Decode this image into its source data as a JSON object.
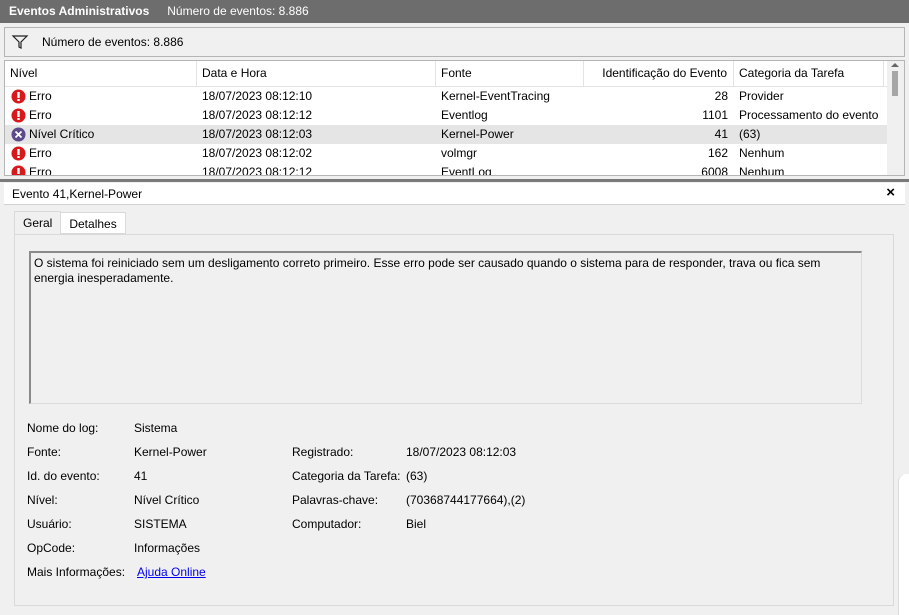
{
  "titlebar": {
    "title": "Eventos Administrativos",
    "count": "Número de eventos: 8.886"
  },
  "filter": {
    "icon": "funnel-icon",
    "count": "Número de eventos: 8.886"
  },
  "table": {
    "columns": [
      "Nível",
      "Data e Hora",
      "Fonte",
      "Identificação do Evento",
      "Categoria da Tarefa"
    ],
    "rows": [
      {
        "icon": "error-icon",
        "level": "Erro",
        "date": "18/07/2023 08:12:10",
        "source": "Kernel-EventTracing",
        "id": "28",
        "category": "Provider"
      },
      {
        "icon": "error-icon",
        "level": "Erro",
        "date": "18/07/2023 08:12:12",
        "source": "Eventlog",
        "id": "1101",
        "category": "Processamento do evento"
      },
      {
        "icon": "critical-icon",
        "level": "Nível Crítico",
        "date": "18/07/2023 08:12:03",
        "source": "Kernel-Power",
        "id": "41",
        "category": "(63)"
      },
      {
        "icon": "error-icon",
        "level": "Erro",
        "date": "18/07/2023 08:12:02",
        "source": "volmgr",
        "id": "162",
        "category": "Nenhum"
      },
      {
        "icon": "error-icon",
        "level": "Erro",
        "date": "18/07/2023 08:12:12",
        "source": "EventLog",
        "id": "6008",
        "category": "Nenhum"
      }
    ]
  },
  "detail": {
    "header": "Evento 41,Kernel-Power",
    "close": "×",
    "tabs": [
      "Geral",
      "Detalhes"
    ],
    "description": "O sistema foi reiniciado sem um desligamento correto primeiro. Esse erro pode ser causado quando o sistema para de responder, trava ou fica sem energia inesperadamente.",
    "fields": {
      "log_label": "Nome do log:",
      "log_value": "Sistema",
      "source_label": "Fonte:",
      "source_value": "Kernel-Power",
      "eventid_label": "Id. do evento:",
      "eventid_value": "41",
      "level_label": "Nível:",
      "level_value": "Nível Crítico",
      "user_label": "Usuário:",
      "user_value": "SISTEMA",
      "opcode_label": "OpCode:",
      "opcode_value": "Informações",
      "more_label": "Mais Informações:",
      "more_link": "Ajuda Online",
      "logged_label": "Registrado:",
      "logged_value": "18/07/2023 08:12:03",
      "task_label": "Categoria da Tarefa:",
      "task_value": "(63)",
      "keywords_label": "Palavras-chave:",
      "keywords_value": "(70368744177664),(2)",
      "computer_label": "Computador:",
      "computer_value": "Biel"
    }
  },
  "colors": {
    "titlebar_bg": "#6d6d6d",
    "error_red": "#d7191c",
    "critical_purple": "#5c4a8a",
    "link_blue": "#0000ee",
    "selected_row": "#e5e5e5"
  }
}
